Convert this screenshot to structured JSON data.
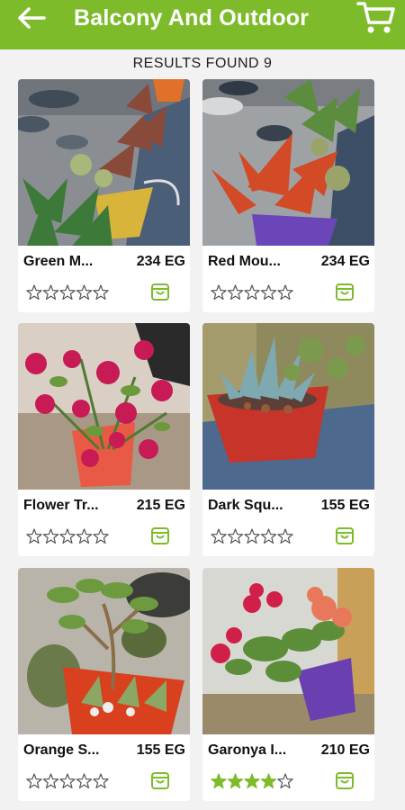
{
  "header": {
    "title": "Balcony And Outdoor",
    "back_icon": "arrow-left-icon",
    "cart_icon": "shopping-cart-icon",
    "background_color": "#7dbb2a"
  },
  "results": {
    "label": "RESULTS FOUND 9"
  },
  "products": [
    {
      "name": "Green M...",
      "price": "234 EG",
      "rating": 0,
      "rating_max": 5,
      "icon": "shopping-bag-icon"
    },
    {
      "name": "Red Mou...",
      "price": "234 EG",
      "rating": 0,
      "rating_max": 5,
      "icon": "shopping-bag-icon"
    },
    {
      "name": "Flower Tr...",
      "price": "215 EG",
      "rating": 0,
      "rating_max": 5,
      "icon": "shopping-bag-icon"
    },
    {
      "name": "Dark Squ...",
      "price": "155 EG",
      "rating": 0,
      "rating_max": 5,
      "icon": "shopping-bag-icon"
    },
    {
      "name": "Orange S...",
      "price": "155 EG",
      "rating": 0,
      "rating_max": 5,
      "icon": "shopping-bag-icon"
    },
    {
      "name": "Garonya I...",
      "price": "210 EG",
      "rating": 4,
      "rating_max": 5,
      "icon": "shopping-bag-icon"
    }
  ],
  "colors": {
    "accent": "#7dbb2a",
    "star_filled": "#7dbb2a",
    "star_empty": "#555555"
  }
}
